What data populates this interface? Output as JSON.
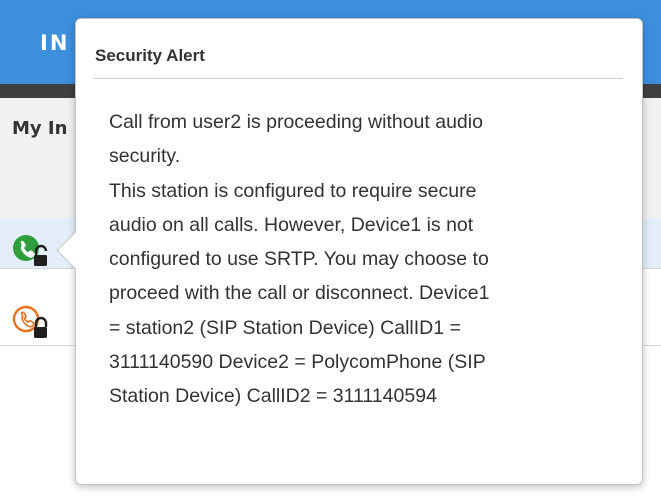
{
  "app": {
    "header_title": "IN",
    "subheader_title": "My In",
    "header_color": "#3d8fdc",
    "active_row_color": "#e3eefa"
  },
  "calls": [
    {
      "icon": "phone-secure-connected-icon",
      "color": "#2e9e3c",
      "state": "active"
    },
    {
      "icon": "phone-secure-ringing-icon",
      "color": "#e8731e",
      "state": "incoming"
    }
  ],
  "security_alert": {
    "title": "Security Alert",
    "lines": [
      "Call from user2 is proceeding without audio",
      "security.",
      "This station is configured to require secure",
      "audio on all calls.  However, Device1 is not",
      "configured to use SRTP. You may choose to",
      "proceed with the call or disconnect.  Device1",
      "= station2 (SIP Station Device) CallID1 =",
      "3111140590 Device2 = PolycomPhone (SIP",
      "Station Device) CallID2 = 3111140594"
    ]
  }
}
